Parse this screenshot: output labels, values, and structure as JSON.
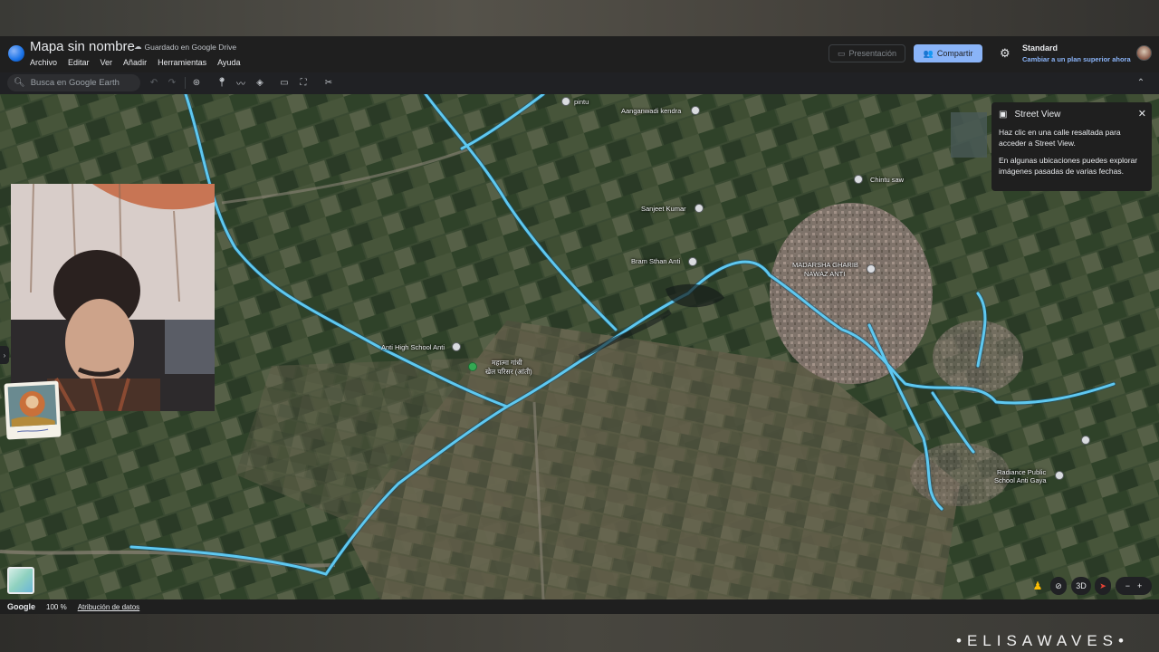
{
  "header": {
    "title": "Mapa sin nombre",
    "saved_status": "Guardado en Google Drive",
    "menu": [
      "Archivo",
      "Editar",
      "Ver",
      "Añadir",
      "Herramientas",
      "Ayuda"
    ],
    "present_label": "Presentación",
    "share_label": "Compartir",
    "plan_name": "Standard",
    "upgrade_label": "Cambiar a un plan superior ahora"
  },
  "toolbar": {
    "search_placeholder": "Busca en Google Earth"
  },
  "map": {
    "places": [
      {
        "name": "pintu"
      },
      {
        "name": "Aanganwadi kendra"
      },
      {
        "name": "Chintu saw"
      },
      {
        "name": "Sanjeet Kumar"
      },
      {
        "name": "Bram Sthan Anti"
      },
      {
        "name": "MADARSHA GHARIB NAWAZ ANTI",
        "line1": "MADARSHA GHARIB",
        "line2": "NAWAZ ANTI"
      },
      {
        "name": "Anti High School Anti"
      },
      {
        "name": "महात्मा गांधी खेल परिसर (आंती)",
        "line1": "महात्मा गांधी",
        "line2": "खेल परिसर (आंती)"
      },
      {
        "name": "Radiance Public School Anti Gaya",
        "line1": "Radiance Public",
        "line2": "School Anti Gaya"
      }
    ],
    "highlight_color": "#5ec8f0"
  },
  "street_view": {
    "title": "Street View",
    "text1": "Haz clic en una calle resaltada para acceder a Street View.",
    "text2": "En algunas ubicaciones puedes explorar imágenes pasadas de varias fechas."
  },
  "footer": {
    "brand": "Google",
    "zoom": "100 %",
    "attribution": "Atribución de datos"
  },
  "controls": {
    "threed_label": "3D"
  },
  "watermark": "•ELISAWAVES•"
}
